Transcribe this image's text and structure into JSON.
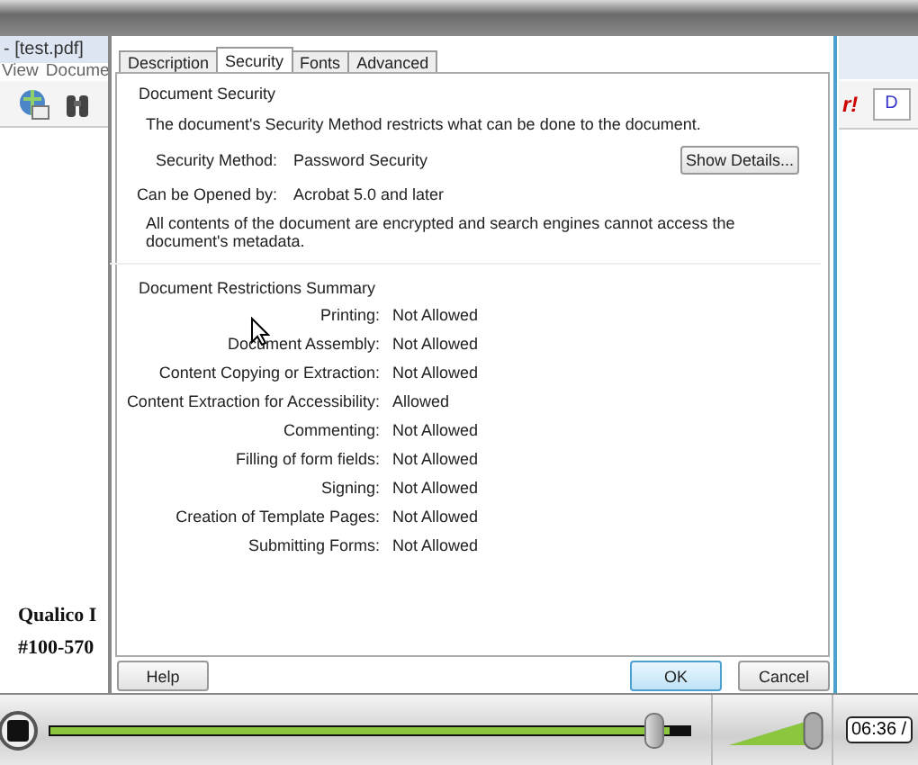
{
  "background_app": {
    "title": "- [test.pdf]",
    "menu": [
      "View",
      "Docume"
    ],
    "toolbar_text": "r!",
    "toolbar_box": "D",
    "document_lines": [
      "Qualico I",
      "#100-570"
    ]
  },
  "dialog": {
    "tabs": [
      {
        "label": "Description",
        "selected": false
      },
      {
        "label": "Security",
        "selected": true
      },
      {
        "label": "Fonts",
        "selected": false
      },
      {
        "label": "Advanced",
        "selected": false
      }
    ],
    "security": {
      "heading": "Document Security",
      "description": "The document's Security Method restricts what can be done to the document.",
      "fields": [
        {
          "label": "Security Method:",
          "value": "Password Security"
        },
        {
          "label": "Can be Opened by:",
          "value": "Acrobat 5.0 and later"
        }
      ],
      "details_button": "Show Details...",
      "note": "All contents of the document are encrypted and search engines cannot access the document's metadata."
    },
    "restrictions": {
      "heading": "Document Restrictions Summary",
      "rows": [
        {
          "label": "Printing:",
          "value": "Not Allowed"
        },
        {
          "label": "Document Assembly:",
          "value": "Not Allowed"
        },
        {
          "label": "Content Copying or Extraction:",
          "value": "Not Allowed"
        },
        {
          "label": "Content Extraction for Accessibility:",
          "value": "Allowed"
        },
        {
          "label": "Commenting:",
          "value": "Not Allowed"
        },
        {
          "label": "Filling of form fields:",
          "value": "Not Allowed"
        },
        {
          "label": "Signing:",
          "value": "Not Allowed"
        },
        {
          "label": "Creation of Template Pages:",
          "value": "Not Allowed"
        },
        {
          "label": "Submitting Forms:",
          "value": "Not Allowed"
        }
      ]
    },
    "buttons": [
      {
        "label": "Help",
        "default": false
      },
      {
        "label": "OK",
        "default": true
      },
      {
        "label": "Cancel",
        "default": false
      }
    ]
  },
  "player": {
    "progress": {
      "level": 0.97
    },
    "volume": {
      "level": 0.9
    },
    "time": "06:36 /"
  }
}
